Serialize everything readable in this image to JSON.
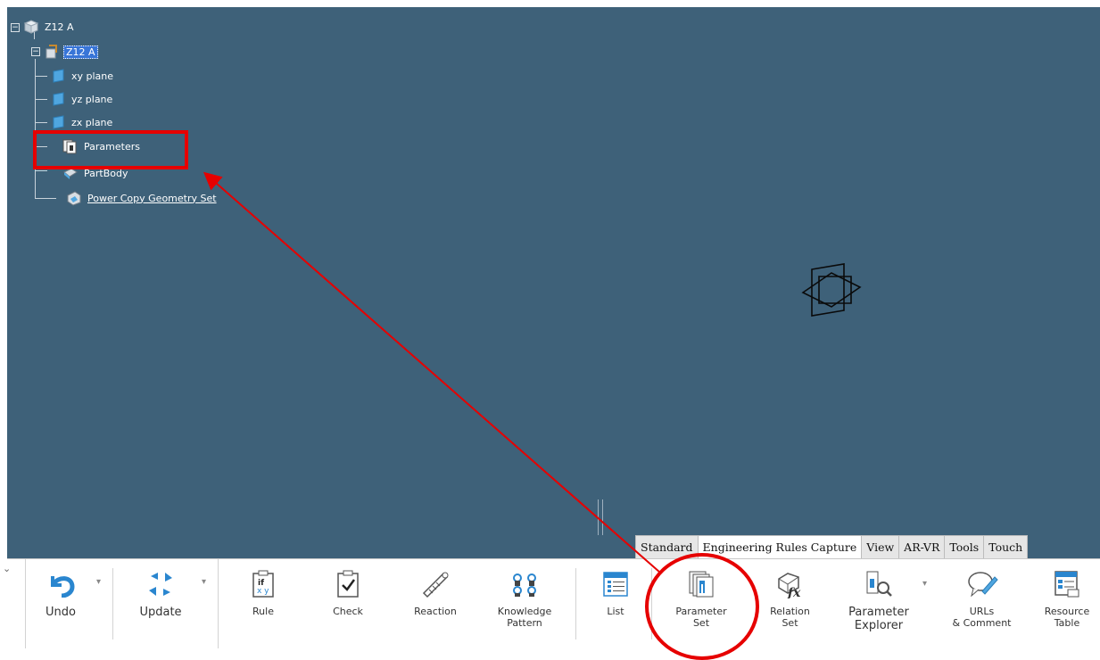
{
  "tree": {
    "root_label": "Z12 A",
    "part_label": "Z12 A",
    "children": [
      {
        "label": "xy plane",
        "icon": "plane-icon"
      },
      {
        "label": "yz plane",
        "icon": "plane-icon"
      },
      {
        "label": "zx plane",
        "icon": "plane-icon"
      },
      {
        "label": "Parameters",
        "icon": "parameters-icon"
      },
      {
        "label": "PartBody",
        "icon": "partbody-icon"
      },
      {
        "label": "Power Copy Geometry Set",
        "icon": "geometry-set-icon"
      }
    ]
  },
  "tabs": [
    {
      "label": "Standard"
    },
    {
      "label": "Engineering Rules Capture",
      "active": true
    },
    {
      "label": "View"
    },
    {
      "label": "AR-VR"
    },
    {
      "label": "Tools"
    },
    {
      "label": "Touch"
    }
  ],
  "toolbar": {
    "undo": "Undo",
    "update": "Update",
    "rule": "Rule",
    "check": "Check",
    "reaction": "Reaction",
    "knowledge_pattern": [
      "Knowledge",
      "Pattern"
    ],
    "list": "List",
    "parameter_set": [
      "Parameter",
      "Set"
    ],
    "relation_set": [
      "Relation",
      "Set"
    ],
    "parameter_explorer": [
      "Parameter",
      "Explorer"
    ],
    "urls_comment": [
      "URLs",
      "& Comment"
    ],
    "resource_table": [
      "Resource",
      "Table"
    ]
  },
  "colors": {
    "viewport_bg": "#3e6179",
    "annotation": "#e60000",
    "selection": "#3875d7"
  }
}
